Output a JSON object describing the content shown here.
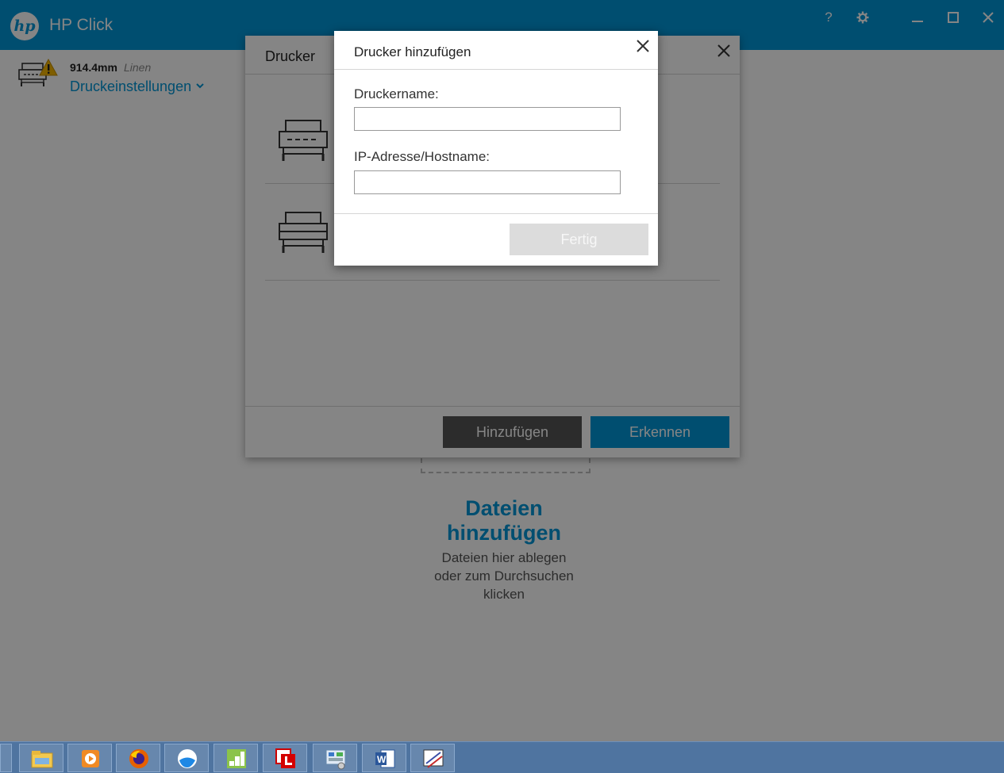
{
  "app": {
    "logo_text": "hp",
    "title": "HP Click"
  },
  "window_controls": {
    "help_glyph": "?"
  },
  "printer_status": {
    "media_width": "914.4mm",
    "media_type": "Linen",
    "settings_label": "Druckeinstellungen"
  },
  "drop_zone": {
    "title_line1": "Dateien",
    "title_line2": "hinzufügen",
    "sub_line1": "Dateien hier ablegen",
    "sub_line2": "oder zum Durchsuchen",
    "sub_line3": "klicken"
  },
  "printers_dialog": {
    "title": "Drucker",
    "add_button": "Hinzufügen",
    "discover_button": "Erkennen"
  },
  "add_printer_dialog": {
    "title": "Drucker hinzufügen",
    "printer_name_label": "Druckername:",
    "printer_name_value": "",
    "ip_label": "IP-Adresse/Hostname:",
    "ip_value": "",
    "done_button": "Fertig"
  },
  "taskbar": {
    "apps": [
      "file-explorer-icon",
      "media-player-icon",
      "firefox-icon",
      "browser-icon",
      "spreadsheet-icon",
      "l-app-icon",
      "control-panel-icon",
      "word-icon",
      "drawing-app-icon"
    ]
  },
  "colors": {
    "brand": "#0096d6",
    "dark_button": "#555555",
    "disabled_button": "#dcdcdc"
  }
}
